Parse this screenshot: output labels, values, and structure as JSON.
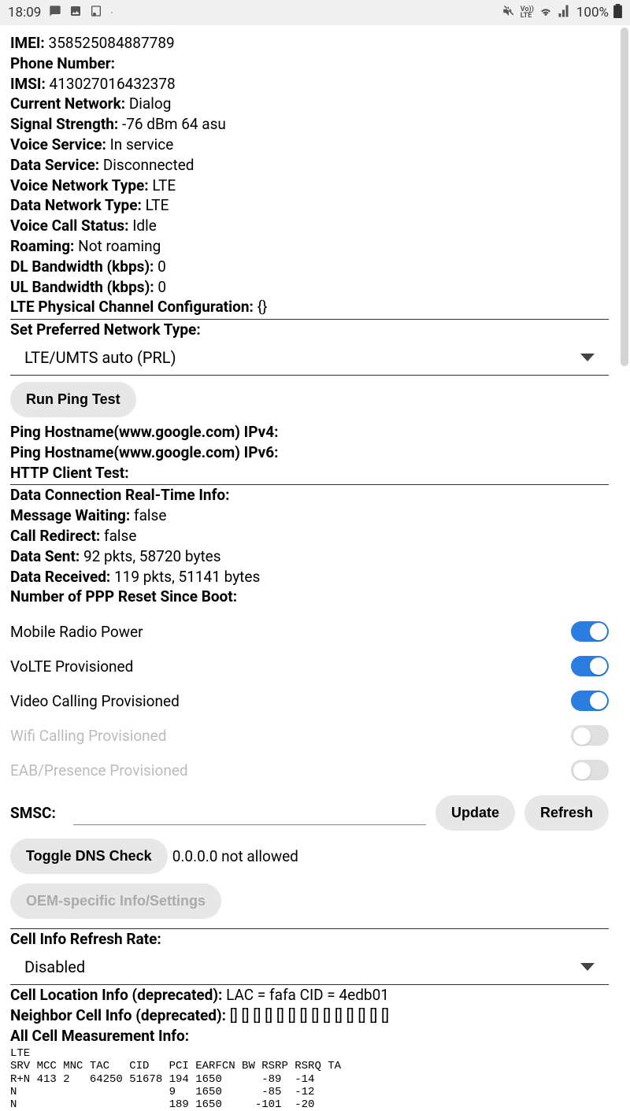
{
  "status_bar": {
    "time": "18:09",
    "battery_pct": "100%"
  },
  "info": {
    "imei_label": "IMEI:",
    "imei_value": "358525084887789",
    "phone_label": "Phone Number:",
    "phone_value": "",
    "imsi_label": "IMSI:",
    "imsi_value": "413027016432378",
    "network_label": "Current Network:",
    "network_value": "Dialog",
    "signal_label": "Signal Strength:",
    "signal_value": "-76 dBm   64 asu",
    "voice_svc_label": "Voice Service:",
    "voice_svc_value": "In service",
    "data_svc_label": "Data Service:",
    "data_svc_value": "Disconnected",
    "voice_net_label": "Voice Network Type:",
    "voice_net_value": "LTE",
    "data_net_label": "Data Network Type:",
    "data_net_value": "LTE",
    "call_status_label": "Voice Call Status:",
    "call_status_value": "Idle",
    "roaming_label": "Roaming:",
    "roaming_value": "Not roaming",
    "dl_bw_label": "DL Bandwidth (kbps):",
    "dl_bw_value": "0",
    "ul_bw_label": "UL Bandwidth (kbps):",
    "ul_bw_value": "0",
    "lte_pcc_label": "LTE Physical Channel Configuration:",
    "lte_pcc_value": "{}"
  },
  "pref_network": {
    "label": "Set Preferred Network Type:",
    "selected": "LTE/UMTS auto (PRL)"
  },
  "ping": {
    "btn": "Run Ping Test",
    "ipv4_label": "Ping Hostname(www.google.com) IPv4:",
    "ipv6_label": "Ping Hostname(www.google.com) IPv6:",
    "http_label": "HTTP Client Test:"
  },
  "realtime": {
    "header": "Data Connection Real-Time Info:",
    "msg_wait_label": "Message Waiting:",
    "msg_wait_value": "false",
    "redirect_label": "Call Redirect:",
    "redirect_value": "false",
    "sent_label": "Data Sent:",
    "sent_value": "92 pkts, 58720 bytes",
    "recv_label": "Data Received:",
    "recv_value": "119 pkts, 51141 bytes",
    "ppp_label": "Number of PPP Reset Since Boot:"
  },
  "toggles": {
    "radio_power": "Mobile Radio Power",
    "volte": "VoLTE Provisioned",
    "video_call": "Video Calling Provisioned",
    "wifi_call": "Wifi Calling Provisioned",
    "eab": "EAB/Presence Provisioned"
  },
  "smsc": {
    "label": "SMSC:",
    "update_btn": "Update",
    "refresh_btn": "Refresh"
  },
  "dns": {
    "btn": "Toggle DNS Check",
    "text": "0.0.0.0 not allowed"
  },
  "oem_btn": "OEM-specific Info/Settings",
  "refresh_rate": {
    "label": "Cell Info Refresh Rate:",
    "selected": "Disabled"
  },
  "cell_loc": {
    "label": "Cell Location Info (deprecated):",
    "value": "LAC = fafa   CID = 4edb01"
  },
  "neighbor": {
    "label": "Neighbor Cell Info (deprecated):",
    "value": "[] [] [] [] [] [] [] [] [] [] [] [] [] []"
  },
  "measurement": {
    "label": "All Cell Measurement Info:",
    "table": "LTE\nSRV MCC MNC TAC   CID   PCI EARFCN BW RSRP RSRQ TA\nR+N 413 2   64250 51678 194 1650      -89  -14\nN                       9   1650      -85  -12\nN                       189 1650     -101  -20"
  }
}
